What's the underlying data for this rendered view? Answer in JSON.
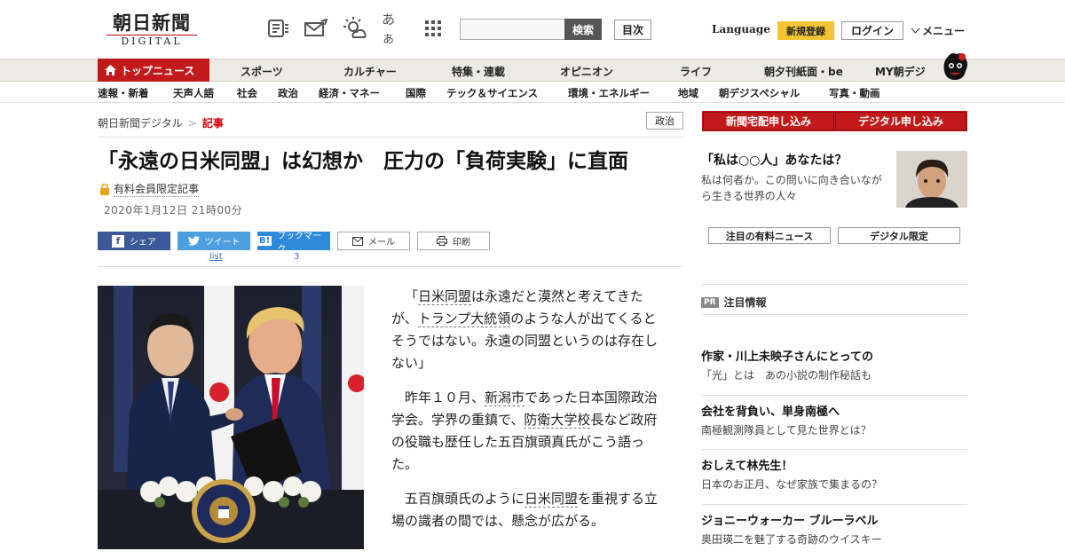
{
  "header": {
    "logo_jp": "朝日新聞",
    "logo_en": "DIGITAL",
    "icons": [
      "newspaper-icon",
      "mail-icon",
      "weather-icon",
      "font-size-icon",
      "grid-icon"
    ],
    "font_size_label": "あぁ",
    "search_button": "検索",
    "search_placeholder": "",
    "index_button": "目次",
    "language": "Language",
    "register": "新規登録",
    "login": "ログイン",
    "menu": "メニュー"
  },
  "nav_primary": {
    "active": "トップニュース",
    "items": [
      "スポーツ",
      "カルチャー",
      "特集・連載",
      "オピニオン",
      "ライフ",
      "朝夕刊紙面・be",
      "MY朝デジ"
    ]
  },
  "nav_secondary": {
    "items": [
      "速報・新着",
      "天声人語",
      "社会",
      "政治",
      "経済・マネー",
      "国際",
      "テック＆サイエンス",
      "環境・エネルギー",
      "地域",
      "朝デジスペシャル",
      "写真・動画"
    ]
  },
  "breadcrumb": {
    "home": "朝日新聞デジタル",
    "sep": ">",
    "current": "記事"
  },
  "category_badge": "政治",
  "article": {
    "title": "「永遠の日米同盟」は幻想か　圧力の「負荷実験」に直面",
    "paid_label": "有料会員限定記事",
    "date": "2020年1月12日 21時00分",
    "share": {
      "facebook": "シェア",
      "twitter": "ツイート",
      "twitter_sub": "list",
      "hatena": "ブックマーク",
      "hatena_sub": "3",
      "mail": "メール",
      "print": "印刷"
    },
    "paragraphs": [
      {
        "pre": "「",
        "kw1": "日米同盟",
        "mid1": "は永遠だと漠然と考えてきたが、",
        "kw2": "トランプ大統領",
        "post": "のような人が出てくるとそうではない。永遠の同盟というのは存在しない」"
      },
      {
        "pre": "昨年１０月、",
        "kw1": "新潟市",
        "mid1": "であった日本国際政治学会。学界の重鎮で、",
        "kw2": "防衛大学校",
        "post": "長など政府の役職も歴任した五百旗頭真氏がこう語った。"
      },
      {
        "pre": "五百旗頭氏のように",
        "kw1": "日米同盟",
        "post": "を重視する立場の識者の間では、懸念が広がる。"
      }
    ]
  },
  "sidebar": {
    "subscribe_paper": "新聞宅配申し込み",
    "subscribe_digital": "デジタル申し込み",
    "feature_title": "「私は○○人」あなたは？",
    "feature_text": "私は何者か。この問いに向き合いながら生きる世界の人々",
    "tab_paid": "注目の有料ニュース",
    "tab_digital": "デジタル限定",
    "pr_tag": "PR",
    "pr_title": "注目情報",
    "ads": [
      {
        "title": "作家・川上未映子さんにとっての",
        "text": "「光」とは　あの小説の制作秘話も"
      },
      {
        "title": "会社を背負い、単身南極へ",
        "text": "南極観測隊員として見た世界とは？"
      },
      {
        "title": "おしえて林先生！",
        "text": "日本のお正月、なぜ家族で集まるの？"
      },
      {
        "title": "ジョニーウォーカー ブルーラベル",
        "text": "奥田瑛二を魅了する奇跡のウイスキー"
      }
    ]
  },
  "colors": {
    "brand_red": "#c21a1a",
    "register_yellow": "#f3c535",
    "facebook": "#3b5998",
    "twitter": "#4d9fe0",
    "hatena": "#2f8ad9"
  }
}
